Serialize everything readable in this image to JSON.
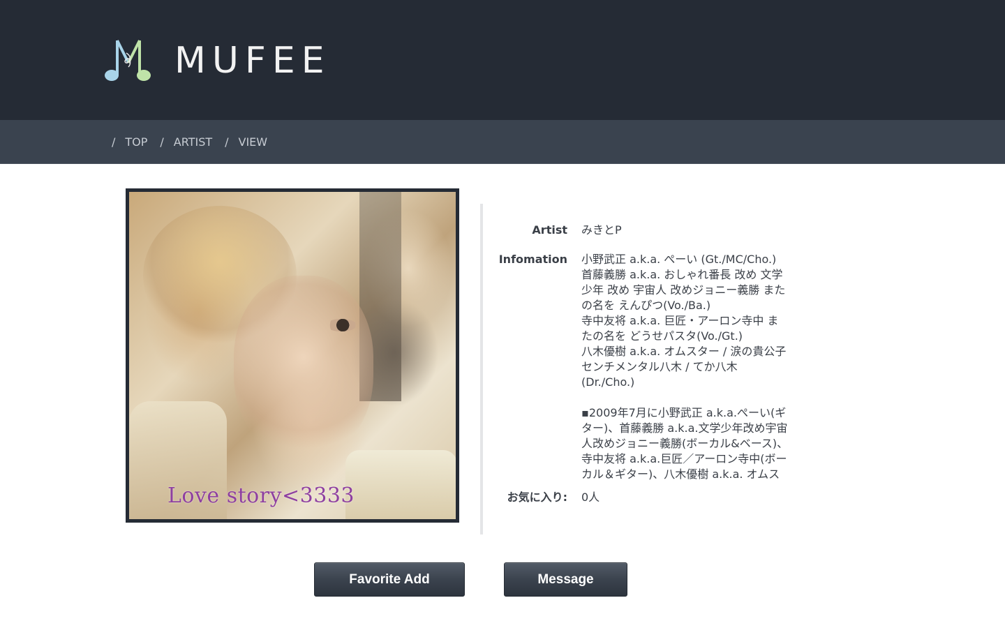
{
  "header": {
    "logo_text": "MUFEE",
    "colors": {
      "background": "#252b35",
      "logo_blue": "#a9d4e9",
      "logo_green": "#bfe3a8"
    }
  },
  "breadcrumb": {
    "separator": "/",
    "items": [
      {
        "label": "TOP"
      },
      {
        "label": "ARTIST"
      },
      {
        "label": "VIEW"
      }
    ]
  },
  "artwork": {
    "caption": "Love story<3333"
  },
  "details": {
    "artist_label": "Artist",
    "artist_value": "みきとP",
    "info_label": "Infomation",
    "info_lines": [
      "小野武正 a.k.a. ぺーい (Gt./MC/Cho.)",
      "首藤義勝 a.k.a. おしゃれ番長 改め 文学",
      "少年 改め 宇宙人 改めジョニー義勝 また",
      "の名を えんぴつ(Vo./Ba.)",
      "寺中友将 a.k.a. 巨匠・アーロン寺中 ま",
      "たの名を どうせパスタ(Vo./Gt.)",
      "八木優樹 a.k.a. オムスター / 涙の貴公子",
      "センチメンタル八木 / てか八木",
      "(Dr./Cho.)",
      "",
      "▪2009年7月に小野武正 a.k.a.ぺーい(ギ",
      "ター)、首藤義勝 a.k.a.文学少年改め宇宙",
      "人改めジョニー義勝(ボーカル&ベース)、",
      "寺中友将 a.k.a.巨匠／アーロン寺中(ボー",
      "カル＆ギター)、八木優樹 a.k.a. オムス"
    ],
    "favorites_label": "お気に入り:",
    "favorites_value": "0人"
  },
  "buttons": {
    "favorite_add": "Favorite Add",
    "message": "Message"
  }
}
